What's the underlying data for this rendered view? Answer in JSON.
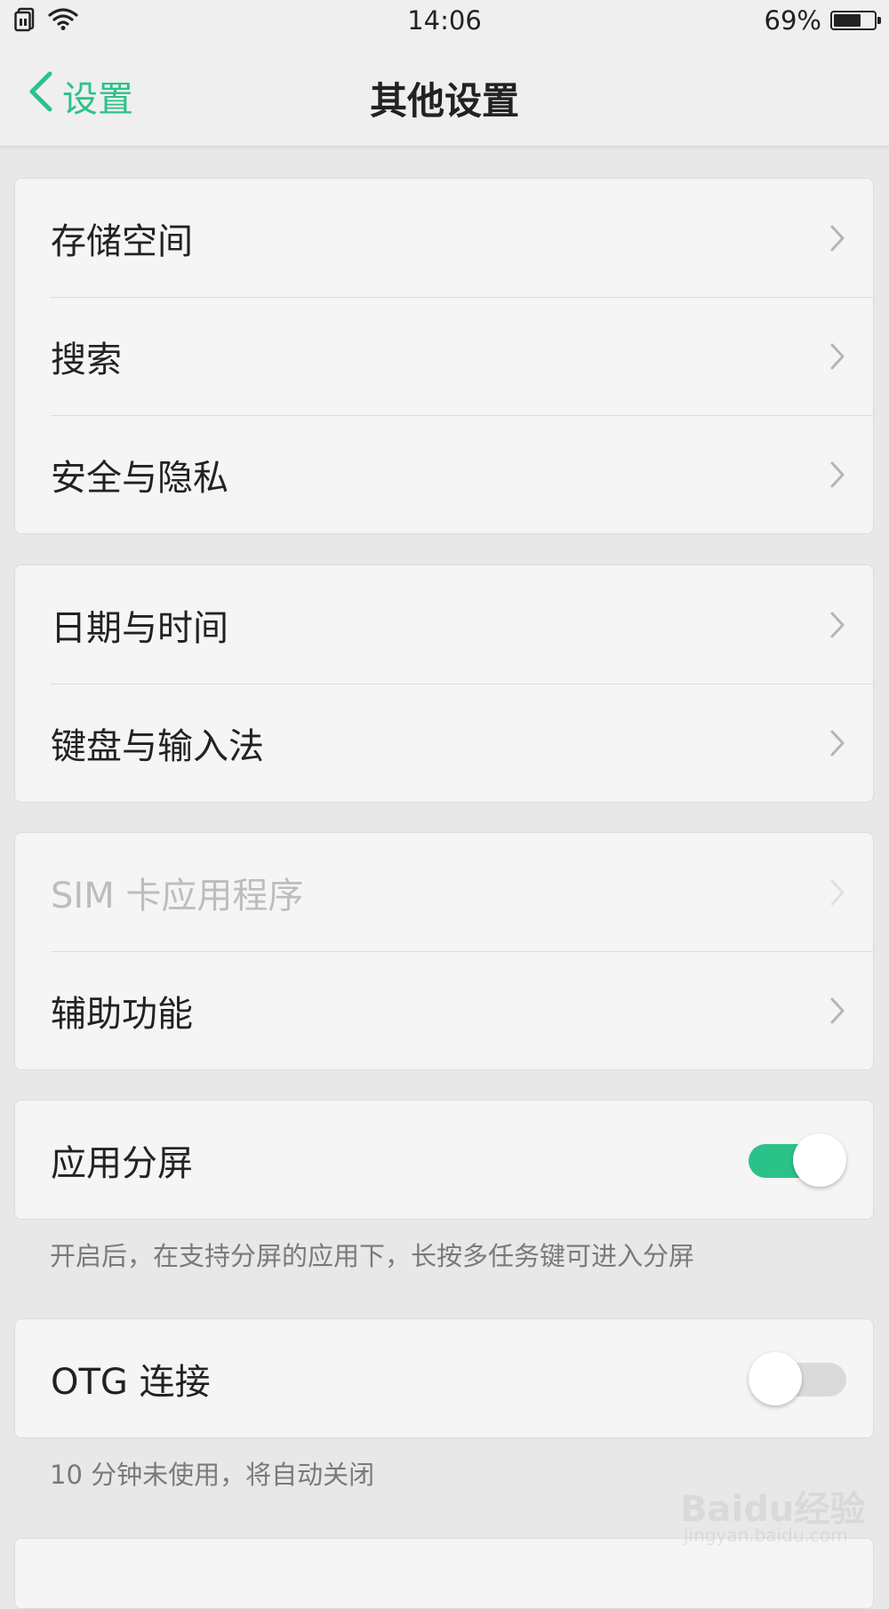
{
  "status_bar": {
    "time": "14:06",
    "battery_percent": "69%",
    "battery_level": 0.69,
    "icons": [
      "sim-icon",
      "wifi-icon",
      "battery-icon"
    ]
  },
  "nav": {
    "back_label": "设置",
    "title": "其他设置"
  },
  "colors": {
    "accent": "#2bc28a",
    "background": "#e8e8e8",
    "card": "#f5f5f5",
    "disabled_text": "#bdbdbd"
  },
  "groups": [
    {
      "items": [
        {
          "label": "存储空间"
        },
        {
          "label": "搜索"
        },
        {
          "label": "安全与隐私"
        }
      ]
    },
    {
      "items": [
        {
          "label": "日期与时间"
        },
        {
          "label": "键盘与输入法"
        }
      ]
    },
    {
      "items": [
        {
          "label": "SIM 卡应用程序",
          "disabled": true
        },
        {
          "label": "辅助功能"
        }
      ]
    },
    {
      "items": [
        {
          "label": "应用分屏",
          "toggle": true,
          "on": true
        }
      ],
      "caption": "开启后，在支持分屏的应用下，长按多任务键可进入分屏"
    },
    {
      "items": [
        {
          "label": "OTG 连接",
          "toggle": true,
          "on": false
        }
      ],
      "caption": "10 分钟未使用，将自动关闭"
    }
  ],
  "watermark": {
    "logo": "Baidu经验",
    "url": "jingyan.baidu.com"
  }
}
